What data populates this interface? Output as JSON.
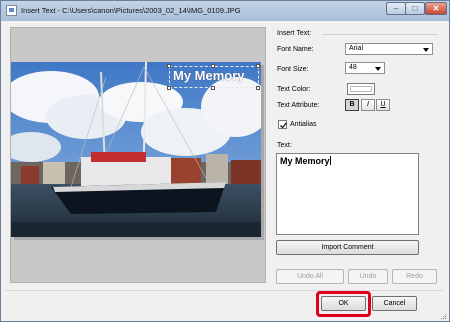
{
  "window": {
    "title": "Insert Text - C:\\Users\\canon\\Pictures\\2003_02_14\\IMG_0109.JPG",
    "controls": {
      "minimize": "–",
      "maximize": "□",
      "close": "✕"
    }
  },
  "preview": {
    "overlay_text": "My Memory"
  },
  "panel": {
    "group_title": "Insert Text:",
    "font_name_label": "Font Name:",
    "font_name_value": "Arial",
    "font_size_label": "Font Size:",
    "font_size_value": "48",
    "text_color_label": "Text Color:",
    "text_color_value": "#ffffff",
    "text_attribute_label": "Text Attribute:",
    "attributes": {
      "bold": "B",
      "italic": "I",
      "underline": "U"
    },
    "antialias_label": "Antialias",
    "antialias_checked": true,
    "text_label": "Text:",
    "text_value": "My Memory",
    "import_comment_label": "Import Comment",
    "undo_all_label": "Undo All",
    "undo_label": "Undo",
    "redo_label": "Redo"
  },
  "footer": {
    "ok_label": "OK",
    "cancel_label": "Cancel"
  },
  "accent_colors": {
    "highlight": "#e0001e"
  }
}
